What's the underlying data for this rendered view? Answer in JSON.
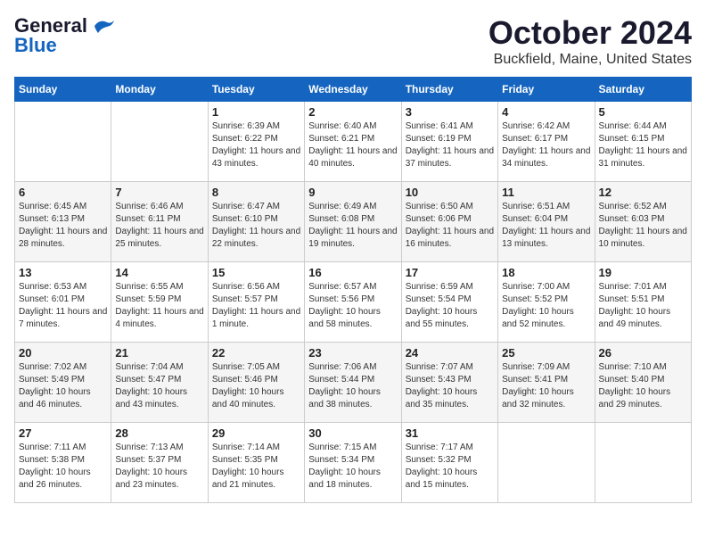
{
  "header": {
    "logo_general": "General",
    "logo_blue": "Blue",
    "title": "October 2024",
    "subtitle": "Buckfield, Maine, United States"
  },
  "weekdays": [
    "Sunday",
    "Monday",
    "Tuesday",
    "Wednesday",
    "Thursday",
    "Friday",
    "Saturday"
  ],
  "weeks": [
    [
      {
        "day": "",
        "sunrise": "",
        "sunset": "",
        "daylight": ""
      },
      {
        "day": "",
        "sunrise": "",
        "sunset": "",
        "daylight": ""
      },
      {
        "day": "1",
        "sunrise": "Sunrise: 6:39 AM",
        "sunset": "Sunset: 6:22 PM",
        "daylight": "Daylight: 11 hours and 43 minutes."
      },
      {
        "day": "2",
        "sunrise": "Sunrise: 6:40 AM",
        "sunset": "Sunset: 6:21 PM",
        "daylight": "Daylight: 11 hours and 40 minutes."
      },
      {
        "day": "3",
        "sunrise": "Sunrise: 6:41 AM",
        "sunset": "Sunset: 6:19 PM",
        "daylight": "Daylight: 11 hours and 37 minutes."
      },
      {
        "day": "4",
        "sunrise": "Sunrise: 6:42 AM",
        "sunset": "Sunset: 6:17 PM",
        "daylight": "Daylight: 11 hours and 34 minutes."
      },
      {
        "day": "5",
        "sunrise": "Sunrise: 6:44 AM",
        "sunset": "Sunset: 6:15 PM",
        "daylight": "Daylight: 11 hours and 31 minutes."
      }
    ],
    [
      {
        "day": "6",
        "sunrise": "Sunrise: 6:45 AM",
        "sunset": "Sunset: 6:13 PM",
        "daylight": "Daylight: 11 hours and 28 minutes."
      },
      {
        "day": "7",
        "sunrise": "Sunrise: 6:46 AM",
        "sunset": "Sunset: 6:11 PM",
        "daylight": "Daylight: 11 hours and 25 minutes."
      },
      {
        "day": "8",
        "sunrise": "Sunrise: 6:47 AM",
        "sunset": "Sunset: 6:10 PM",
        "daylight": "Daylight: 11 hours and 22 minutes."
      },
      {
        "day": "9",
        "sunrise": "Sunrise: 6:49 AM",
        "sunset": "Sunset: 6:08 PM",
        "daylight": "Daylight: 11 hours and 19 minutes."
      },
      {
        "day": "10",
        "sunrise": "Sunrise: 6:50 AM",
        "sunset": "Sunset: 6:06 PM",
        "daylight": "Daylight: 11 hours and 16 minutes."
      },
      {
        "day": "11",
        "sunrise": "Sunrise: 6:51 AM",
        "sunset": "Sunset: 6:04 PM",
        "daylight": "Daylight: 11 hours and 13 minutes."
      },
      {
        "day": "12",
        "sunrise": "Sunrise: 6:52 AM",
        "sunset": "Sunset: 6:03 PM",
        "daylight": "Daylight: 11 hours and 10 minutes."
      }
    ],
    [
      {
        "day": "13",
        "sunrise": "Sunrise: 6:53 AM",
        "sunset": "Sunset: 6:01 PM",
        "daylight": "Daylight: 11 hours and 7 minutes."
      },
      {
        "day": "14",
        "sunrise": "Sunrise: 6:55 AM",
        "sunset": "Sunset: 5:59 PM",
        "daylight": "Daylight: 11 hours and 4 minutes."
      },
      {
        "day": "15",
        "sunrise": "Sunrise: 6:56 AM",
        "sunset": "Sunset: 5:57 PM",
        "daylight": "Daylight: 11 hours and 1 minute."
      },
      {
        "day": "16",
        "sunrise": "Sunrise: 6:57 AM",
        "sunset": "Sunset: 5:56 PM",
        "daylight": "Daylight: 10 hours and 58 minutes."
      },
      {
        "day": "17",
        "sunrise": "Sunrise: 6:59 AM",
        "sunset": "Sunset: 5:54 PM",
        "daylight": "Daylight: 10 hours and 55 minutes."
      },
      {
        "day": "18",
        "sunrise": "Sunrise: 7:00 AM",
        "sunset": "Sunset: 5:52 PM",
        "daylight": "Daylight: 10 hours and 52 minutes."
      },
      {
        "day": "19",
        "sunrise": "Sunrise: 7:01 AM",
        "sunset": "Sunset: 5:51 PM",
        "daylight": "Daylight: 10 hours and 49 minutes."
      }
    ],
    [
      {
        "day": "20",
        "sunrise": "Sunrise: 7:02 AM",
        "sunset": "Sunset: 5:49 PM",
        "daylight": "Daylight: 10 hours and 46 minutes."
      },
      {
        "day": "21",
        "sunrise": "Sunrise: 7:04 AM",
        "sunset": "Sunset: 5:47 PM",
        "daylight": "Daylight: 10 hours and 43 minutes."
      },
      {
        "day": "22",
        "sunrise": "Sunrise: 7:05 AM",
        "sunset": "Sunset: 5:46 PM",
        "daylight": "Daylight: 10 hours and 40 minutes."
      },
      {
        "day": "23",
        "sunrise": "Sunrise: 7:06 AM",
        "sunset": "Sunset: 5:44 PM",
        "daylight": "Daylight: 10 hours and 38 minutes."
      },
      {
        "day": "24",
        "sunrise": "Sunrise: 7:07 AM",
        "sunset": "Sunset: 5:43 PM",
        "daylight": "Daylight: 10 hours and 35 minutes."
      },
      {
        "day": "25",
        "sunrise": "Sunrise: 7:09 AM",
        "sunset": "Sunset: 5:41 PM",
        "daylight": "Daylight: 10 hours and 32 minutes."
      },
      {
        "day": "26",
        "sunrise": "Sunrise: 7:10 AM",
        "sunset": "Sunset: 5:40 PM",
        "daylight": "Daylight: 10 hours and 29 minutes."
      }
    ],
    [
      {
        "day": "27",
        "sunrise": "Sunrise: 7:11 AM",
        "sunset": "Sunset: 5:38 PM",
        "daylight": "Daylight: 10 hours and 26 minutes."
      },
      {
        "day": "28",
        "sunrise": "Sunrise: 7:13 AM",
        "sunset": "Sunset: 5:37 PM",
        "daylight": "Daylight: 10 hours and 23 minutes."
      },
      {
        "day": "29",
        "sunrise": "Sunrise: 7:14 AM",
        "sunset": "Sunset: 5:35 PM",
        "daylight": "Daylight: 10 hours and 21 minutes."
      },
      {
        "day": "30",
        "sunrise": "Sunrise: 7:15 AM",
        "sunset": "Sunset: 5:34 PM",
        "daylight": "Daylight: 10 hours and 18 minutes."
      },
      {
        "day": "31",
        "sunrise": "Sunrise: 7:17 AM",
        "sunset": "Sunset: 5:32 PM",
        "daylight": "Daylight: 10 hours and 15 minutes."
      },
      {
        "day": "",
        "sunrise": "",
        "sunset": "",
        "daylight": ""
      },
      {
        "day": "",
        "sunrise": "",
        "sunset": "",
        "daylight": ""
      }
    ]
  ]
}
